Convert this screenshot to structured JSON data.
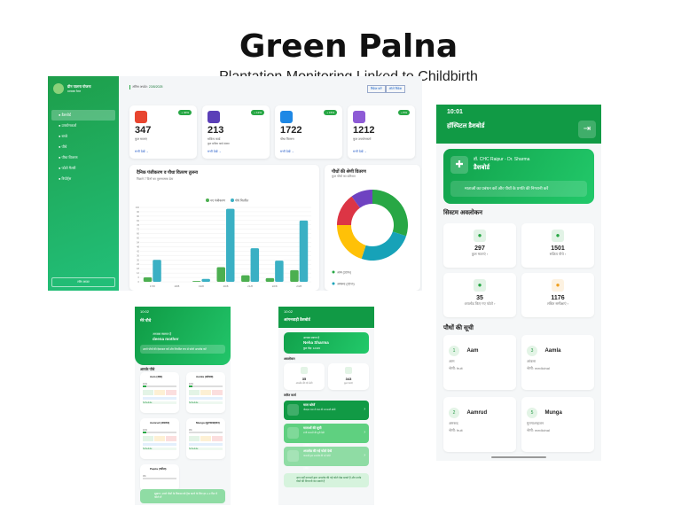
{
  "header": {
    "title": "Green Palna",
    "subtitle": "Plantation Monitoring Linked to Childbirth"
  },
  "web": {
    "sidebar": {
      "brand": "ग्रीन पालना योजना",
      "sub": "प्रशासक पैनल",
      "items": [
        {
          "label": "डैशबोर्ड",
          "active": true
        },
        {
          "label": "उपयोगकर्ता"
        },
        {
          "label": "बच्चे"
        },
        {
          "label": "पौधे"
        },
        {
          "label": "पौधा वितरण"
        },
        {
          "label": "फोटो गैलरी"
        },
        {
          "label": "रिपोर्ट्स"
        }
      ],
      "logout": "लॉग आउट"
    },
    "topbar": {
      "updated_label": "अंतिम अपडेट:",
      "updated_date": "23/8/2025",
      "refresh": "रिफ्रेश करें",
      "export": "ऑटो रिफ्रेश"
    },
    "stats": [
      {
        "value": "347",
        "label": "कुल माताएं",
        "badge": "+ 40%",
        "link": "सभी देखें →",
        "color": "#e8452f"
      },
      {
        "value": "213",
        "label": "सक्रिय कार्ड",
        "sub": "कुल सक्रिय कार्ड संख्या",
        "badge": "+ 12%",
        "link": "सभी देखें →",
        "color": "#5b3fb8"
      },
      {
        "value": "1722",
        "label": "पौधा वितरण",
        "badge": "+ 15%",
        "link": "सभी देखें →",
        "color": "#1e88e5"
      },
      {
        "value": "1212",
        "label": "कुल उपयोगकर्ता",
        "badge": "+ 5%",
        "link": "सभी देखें →",
        "color": "#8e5bd6"
      }
    ]
  },
  "chart_data": [
    {
      "type": "bar",
      "title": "दैनिक पंजीकरण व पौधा वितरण तुलना",
      "subtitle": "पिछले 7 दिनों का तुलनात्मक डेटा",
      "categories": [
        "17/8",
        "18/8",
        "19/8",
        "20/8",
        "21/8",
        "22/8",
        "23/8"
      ],
      "series": [
        {
          "name": "नए पंजीकरण",
          "color": "#4caf50",
          "values": [
            6,
            0,
            1,
            20,
            9,
            5,
            16
          ]
        },
        {
          "name": "पौधे वितरित",
          "color": "#3ab0c4",
          "values": [
            30,
            0,
            4,
            100,
            46,
            29,
            84
          ]
        }
      ],
      "ylim": [
        0,
        102
      ],
      "yticks": [
        0,
        6,
        12,
        18,
        24,
        30,
        36,
        42,
        48,
        54,
        60,
        66,
        72,
        78,
        84,
        90,
        96,
        102
      ],
      "grid": true,
      "legend": "top"
    },
    {
      "type": "pie",
      "title": "पौधों की श्रेणी वितरण",
      "subtitle": "कुल पौधों का प्रतिशत",
      "slices": [
        {
          "name": "आम (30%)",
          "value": 30,
          "color": "#28a745"
        },
        {
          "name": "अमरूद (25%)",
          "value": 25,
          "color": "#17a2b8"
        },
        {
          "value": 20,
          "color": "#ffc107"
        },
        {
          "value": 15,
          "color": "#dc3545"
        },
        {
          "value": 10,
          "color": "#6f42c1"
        }
      ]
    }
  ],
  "hospital": {
    "time": "10:01",
    "title": "हॉस्पिटल डैशबोर्ड",
    "hosp_name": "डॉ. CHC Raipur - Dr. Sharma",
    "hosp_title": "डैशबोर्ड",
    "note": "माताओं का प्रबंधन करें और पौधों के प्रगति की निगरानी करें",
    "overview": "सिस्टम अवलोकन",
    "stats": [
      {
        "value": "297",
        "label": "कुल माताएं",
        "color": "#28a745"
      },
      {
        "value": "1501",
        "label": "सक्रिय पौधे",
        "color": "#28a745"
      },
      {
        "value": "35",
        "label": "अपलोड किए गए फोटो",
        "color": "#28a745"
      },
      {
        "value": "1176",
        "label": "लंबित समीक्षाएं",
        "color": "#f0a020"
      }
    ],
    "plants_title": "पौधों की सूची",
    "plants": [
      {
        "no": "1",
        "name": "Aam",
        "hindi": "आम",
        "cat": "श्रेणी: fruit"
      },
      {
        "no": "3",
        "name": "Aamla",
        "hindi": "आंवला",
        "cat": "श्रेणी: medicinal"
      },
      {
        "no": "2",
        "name": "Aamrud",
        "hindi": "अमरूद",
        "cat": "श्रेणी: fruit"
      },
      {
        "no": "5",
        "name": "Munga",
        "hindi": "मुनगा/सहजन",
        "cat": "श्रेणी: medicinal"
      }
    ]
  },
  "mother": {
    "time": "10:02",
    "title": "मेरे पौधे",
    "welcome": "आपका स्वागत है",
    "name": "deena mother",
    "note": "अपने पौधों की देखभाल करें और नियमित रूप से फोटो अपलोड करें",
    "section": "आपके पौधे",
    "plants": [
      {
        "name": "Aam (आम)",
        "pct": "10%"
      },
      {
        "name": "Aamla (आंवला)",
        "pct": "10%"
      },
      {
        "name": "Aamrud (अमरूद)",
        "pct": "10%"
      },
      {
        "name": "Munga (मुनगा/सहजन)",
        "pct": "0%"
      },
      {
        "name": "Papita (पपीता)",
        "pct": "0%"
      }
    ],
    "schedule": "Schedule",
    "tip": "सुझाव: अपने पौधों के विकास को ट्रैक करने के लिए हर 2-3 दिन में फोटो लें"
  },
  "anganwadi": {
    "time": "10:02",
    "title": "आंगनवाड़ी डैशबोर्ड",
    "welcome": "आपका स्वागत है",
    "name": "Neha Sharma",
    "sub": "कुल केंद्र: 12345",
    "overview": "अवलोकन",
    "stats": [
      {
        "value": "35",
        "label": "अपलोड की गई फोटो"
      },
      {
        "value": "343",
        "label": "कुल माताएं"
      }
    ],
    "actions_title": "त्वरित कार्य",
    "actions": [
      {
        "title": "माता खोजें",
        "desc": "मोबाइल नंबर से माता की जानकारी खोजें",
        "tag": "खोजें"
      },
      {
        "title": "माताओं की सूची",
        "desc": "सभी माताओं की सूची देखें",
        "tag": "343"
      },
      {
        "title": "अपलोड की गई फोटो देखें",
        "desc": "माताओं द्वारा अपलोड की गई फोटो",
        "tag": "35"
      }
    ],
    "footer": "आप यहाँ माताओं द्वारा अपलोड की गई फोटो देख सकते हैं और उनके पौधों की निगरानी कर सकते हैं"
  }
}
